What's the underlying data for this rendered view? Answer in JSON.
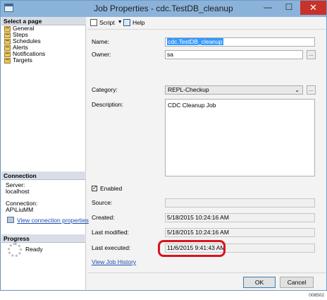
{
  "window": {
    "title": "Job Properties - cdc.TestDB_cleanup",
    "minimize": "—",
    "maximize": "☐",
    "close": "✕"
  },
  "sidebar": {
    "select_header": "Select a page",
    "pages": [
      {
        "label": "General",
        "icon": "page-icon"
      },
      {
        "label": "Steps",
        "icon": "page-icon"
      },
      {
        "label": "Schedules",
        "icon": "page-icon"
      },
      {
        "label": "Alerts",
        "icon": "page-icon"
      },
      {
        "label": "Notifications",
        "icon": "page-icon"
      },
      {
        "label": "Targets",
        "icon": "page-icon"
      }
    ],
    "connection_header": "Connection",
    "server_label": "Server:",
    "server_value": "localhost",
    "connection_label": "Connection:",
    "connection_value": "AP\\LiuMM",
    "view_connection_link": "View connection properties",
    "progress_header": "Progress",
    "progress_status": "Ready"
  },
  "toolbar": {
    "script_label": "Script",
    "help_label": "Help"
  },
  "form": {
    "name_label": "Name:",
    "name_value": "cdc.TestDB_cleanup",
    "owner_label": "Owner:",
    "owner_value": "sa",
    "category_label": "Category:",
    "category_value": "REPL-Checkup",
    "description_label": "Description:",
    "description_value": "CDC Cleanup Job",
    "enabled_label": "Enabled",
    "enabled_checked": true,
    "check_mark": "✓",
    "source_label": "Source:",
    "source_value": "",
    "created_label": "Created:",
    "created_value": "5/18/2015 10:24:16 AM",
    "modified_label": "Last modified:",
    "modified_value": "5/18/2015 10:24:16 AM",
    "executed_label": "Last executed:",
    "executed_value": "11/6/2015 9:41:43 AM",
    "history_link": "View Job History",
    "ellipsis": "...",
    "dropdown_arrow": "⌄"
  },
  "buttons": {
    "ok_label": "OK",
    "cancel_label": "Cancel"
  },
  "figure_id": "008502",
  "colors": {
    "highlight": "#d9141e",
    "close": "#c7322b",
    "titlebar": "#8bb3da",
    "selection": "#3399ff"
  }
}
